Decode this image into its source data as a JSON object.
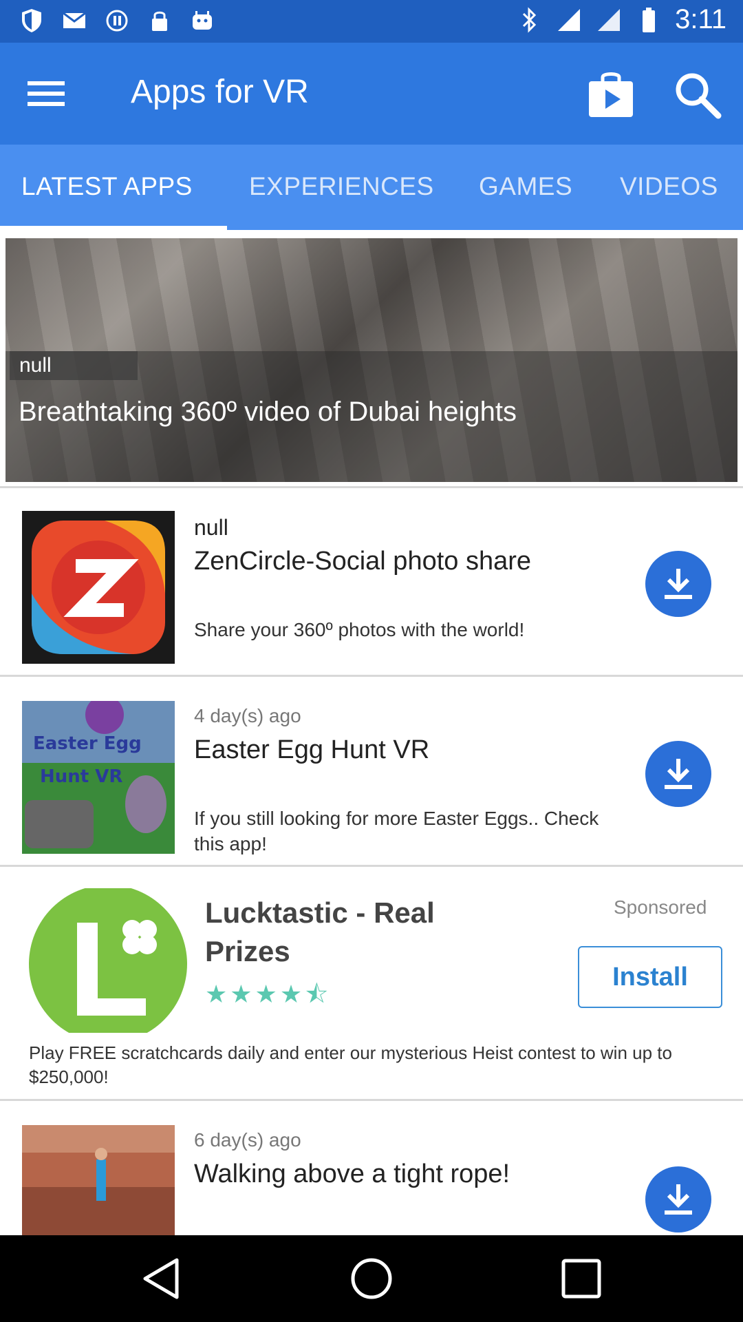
{
  "status_bar": {
    "time": "3:11",
    "icons_left": [
      "shield-icon",
      "mail-icon",
      "stop-icon",
      "lock-icon",
      "android-icon"
    ],
    "icons_right": [
      "bluetooth-icon",
      "signal-icon",
      "wifi-icon",
      "battery-icon"
    ]
  },
  "app_bar": {
    "title": "Apps for VR",
    "menu_icon": "hamburger-menu-icon",
    "store_icon": "play-store-icon",
    "search_icon": "search-icon"
  },
  "tabs": [
    {
      "label": "LATEST APPS",
      "active": true
    },
    {
      "label": "EXPERIENCES",
      "active": false
    },
    {
      "label": "GAMES",
      "active": false
    },
    {
      "label": "VIDEOS",
      "active": false
    }
  ],
  "hero": {
    "tag": "null",
    "caption": "Breathtaking 360º video of Dubai heights"
  },
  "items": [
    {
      "meta": "null",
      "title": "ZenCircle-Social photo share",
      "description": "Share your 360º photos with the world!",
      "icon": "download-icon"
    },
    {
      "meta": "4 day(s) ago",
      "title": "Easter Egg Hunt VR",
      "description": "If you still looking for more Easter Eggs.. Check this app!",
      "thumb_text": "Easter Egg Hunt VR",
      "icon": "download-icon"
    },
    {
      "meta": "6 day(s) ago",
      "title": "Walking above a tight rope!",
      "icon": "download-icon"
    }
  ],
  "ad": {
    "sponsored": "Sponsored",
    "title": "Lucktastic - Real Prizes",
    "rating_stars": 4.5,
    "stars_display": "★★★★⯪",
    "install": "Install",
    "description": "Play FREE scratchcards daily and enter our mysterious Heist contest to win up to $250,000!"
  },
  "nav_bar": {
    "icons": [
      "back-icon",
      "home-icon",
      "recents-icon"
    ]
  },
  "colors": {
    "status_bar": "#1f5fbf",
    "app_bar": "#2e78df",
    "tab_bar": "#4a8ff0",
    "download_button": "#2b6fd8",
    "ad_accent": "#5bc8b0"
  }
}
